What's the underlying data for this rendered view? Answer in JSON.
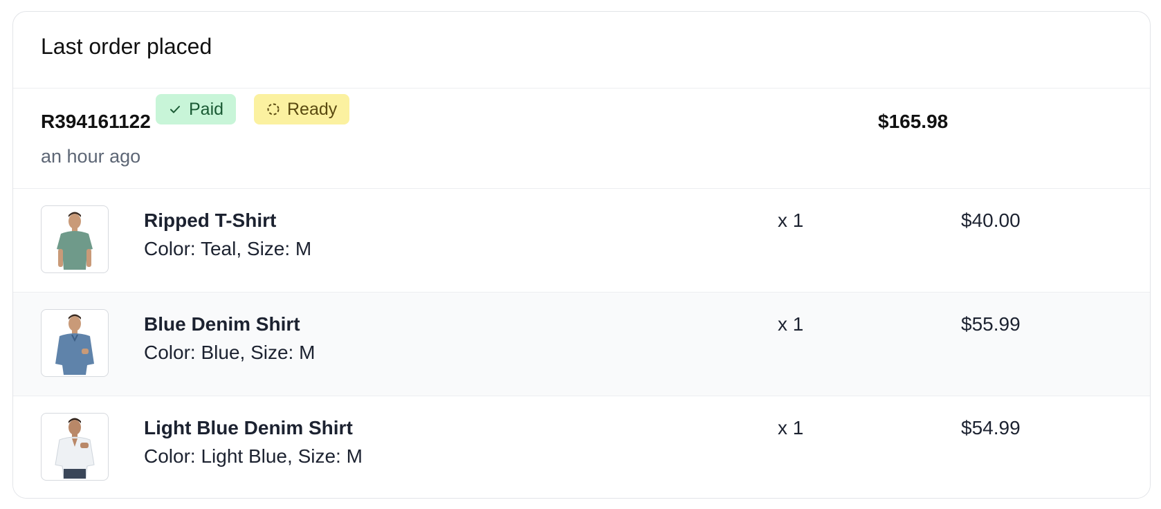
{
  "card": {
    "title": "Last order placed"
  },
  "order": {
    "id": "R394161122",
    "time": "an hour ago",
    "total": "$165.98",
    "badges": {
      "paid": {
        "label": "Paid",
        "icon": "check-icon",
        "bg": "#c8f5d8",
        "fg": "#1a5a34"
      },
      "ready": {
        "label": "Ready",
        "icon": "dashed-circle-icon",
        "bg": "#fbf1a0",
        "fg": "#5a4a10"
      }
    }
  },
  "items": [
    {
      "name": "Ripped T-Shirt",
      "variant": "Color: Teal, Size: M",
      "qty": "x 1",
      "price": "$40.00",
      "shirt_color": "#6f9a8a"
    },
    {
      "name": "Blue Denim Shirt",
      "variant": "Color: Blue, Size: M",
      "qty": "x 1",
      "price": "$55.99",
      "shirt_color": "#5f83aa"
    },
    {
      "name": "Light Blue Denim Shirt",
      "variant": "Color: Light Blue, Size: M",
      "qty": "x 1",
      "price": "$54.99",
      "shirt_color": "#eef1f4"
    }
  ]
}
